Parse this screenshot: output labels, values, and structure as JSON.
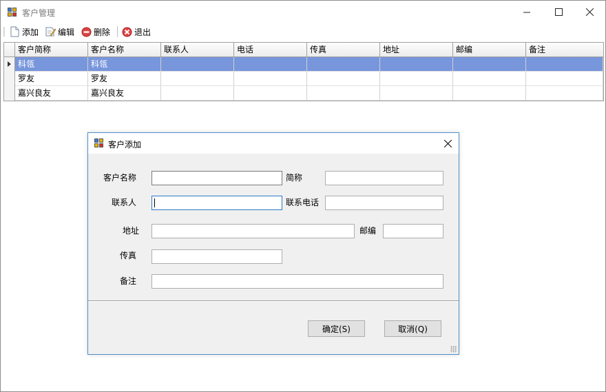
{
  "window": {
    "title": "客户管理"
  },
  "toolbar": {
    "add_label": "添加",
    "edit_label": "编辑",
    "delete_label": "删除",
    "exit_label": "退出"
  },
  "grid": {
    "columns": [
      "客户简称",
      "客户名称",
      "联系人",
      "电话",
      "传真",
      "地址",
      "邮编",
      "备注"
    ],
    "rows": [
      [
        "科瓴",
        "科瓴",
        "",
        "",
        "",
        "",
        "",
        ""
      ],
      [
        "罗友",
        "罗友",
        "",
        "",
        "",
        "",
        "",
        ""
      ],
      [
        "嘉兴良友",
        "嘉兴良友",
        "",
        "",
        "",
        "",
        "",
        ""
      ]
    ],
    "selected_row": 0
  },
  "dialog": {
    "title": "客户添加",
    "labels": {
      "customer_name": "客户名称",
      "short_name": "简称",
      "contact": "联系人",
      "contact_phone": "联系电话",
      "address": "地址",
      "postcode": "邮编",
      "fax": "传真",
      "remark": "备注"
    },
    "values": {
      "customer_name": "",
      "short_name": "",
      "contact": "",
      "contact_phone": "",
      "address": "",
      "postcode": "",
      "fax": "",
      "remark": ""
    },
    "ok_label": "确定(S)",
    "cancel_label": "取消(Q)"
  },
  "colors": {
    "selection": "#7896dc",
    "focus_border": "#2b79c4",
    "dialog_border": "#4f8fc7"
  }
}
